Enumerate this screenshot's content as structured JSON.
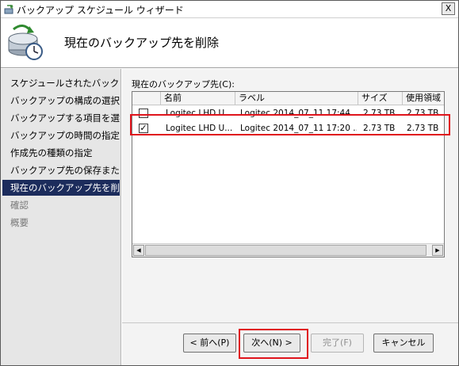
{
  "window": {
    "title": "バックアップ スケジュール ウィザード",
    "close_label": "X"
  },
  "header": {
    "title": "現在のバックアップ先を削除"
  },
  "steps": [
    {
      "label": "スケジュールされたバックア..."
    },
    {
      "label": "バックアップの構成の選択"
    },
    {
      "label": "バックアップする項目を選..."
    },
    {
      "label": "バックアップの時間の指定"
    },
    {
      "label": "作成先の種類の指定"
    },
    {
      "label": "バックアップ先の保存また..."
    },
    {
      "label": "現在のバックアップ先を削..."
    },
    {
      "label": "確認"
    },
    {
      "label": "概要"
    }
  ],
  "list": {
    "label": "現在のバックアップ先(C):",
    "columns": [
      "",
      "名前",
      "ラベル",
      "サイズ",
      "使用領域"
    ],
    "rows": [
      {
        "checked": false,
        "name": "Logitec LHD U...",
        "label": "Logitec 2014_07_11 17:44 ...",
        "size": "2.73 TB",
        "used": "2.73 TB"
      },
      {
        "checked": true,
        "name": "Logitec LHD U...",
        "label": "Logitec 2014_07_11 17:20 ...",
        "size": "2.73 TB",
        "used": "2.73 TB"
      }
    ]
  },
  "buttons": {
    "back": "< 前へ(P)",
    "next": "次へ(N) >",
    "finish": "完了(F)",
    "cancel": "キャンセル"
  },
  "colors": {
    "active_step": "#1c2c5c",
    "highlight": "#e0141c"
  }
}
